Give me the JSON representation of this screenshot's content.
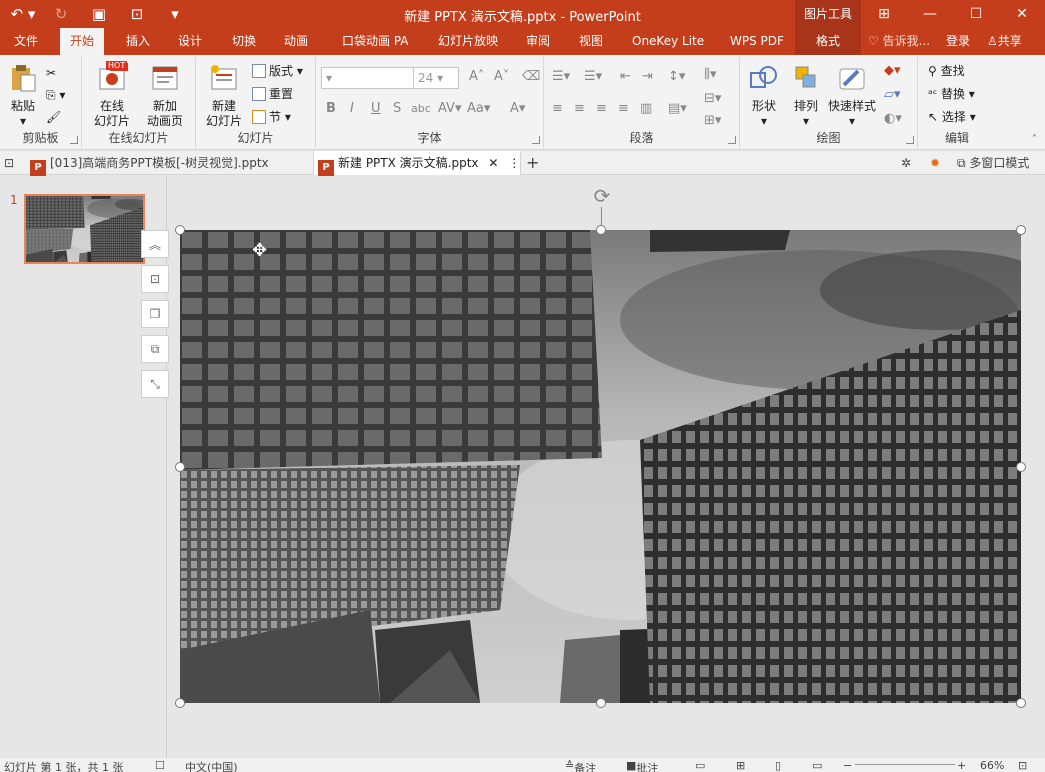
{
  "titlebar": {
    "title": "新建 PPTX 演示文稿.pptx - PowerPoint",
    "context_tab": "图片工具"
  },
  "tabs": {
    "file": "文件",
    "home": "开始",
    "insert": "插入",
    "design": "设计",
    "transitions": "切换",
    "animations": "动画",
    "pocket": "口袋动画 PA",
    "slideshow": "幻灯片放映",
    "review": "审阅",
    "view": "视图",
    "onekey": "OneKey Lite",
    "wpspdf": "WPS PDF",
    "format": "格式",
    "tellme": "告诉我...",
    "login": "登录",
    "share": "共享"
  },
  "ribbon": {
    "clipboard": {
      "label": "剪贴板",
      "paste": "粘贴"
    },
    "online": {
      "label": "在线幻灯片",
      "online_slide": "在线\n幻灯片",
      "new_anim": "新加\n动画页",
      "hot": "HOT"
    },
    "slides": {
      "label": "幻灯片",
      "new_slide": "新建\n幻灯片",
      "layout": "版式",
      "reset": "重置",
      "section": "节"
    },
    "font": {
      "label": "字体",
      "size": "24"
    },
    "paragraph": {
      "label": "段落"
    },
    "drawing": {
      "label": "绘图",
      "shapes": "形状",
      "arrange": "排列",
      "quick_styles": "快速样式"
    },
    "editing": {
      "label": "编辑",
      "find": "查找",
      "replace": "替换",
      "select": "选择"
    }
  },
  "doctabs": {
    "tab1": "[013]高端商务PPT模板[-树灵视觉].pptx",
    "tab2": "新建 PPTX 演示文稿.pptx",
    "multiwindow": "多窗口模式"
  },
  "thumbs": {
    "number": "1"
  },
  "status": {
    "slide_info": "幻灯片 第 1 张，共 1 张",
    "language": "中文(中国)",
    "notes": "备注",
    "comments": "批注",
    "zoom": "66%"
  }
}
